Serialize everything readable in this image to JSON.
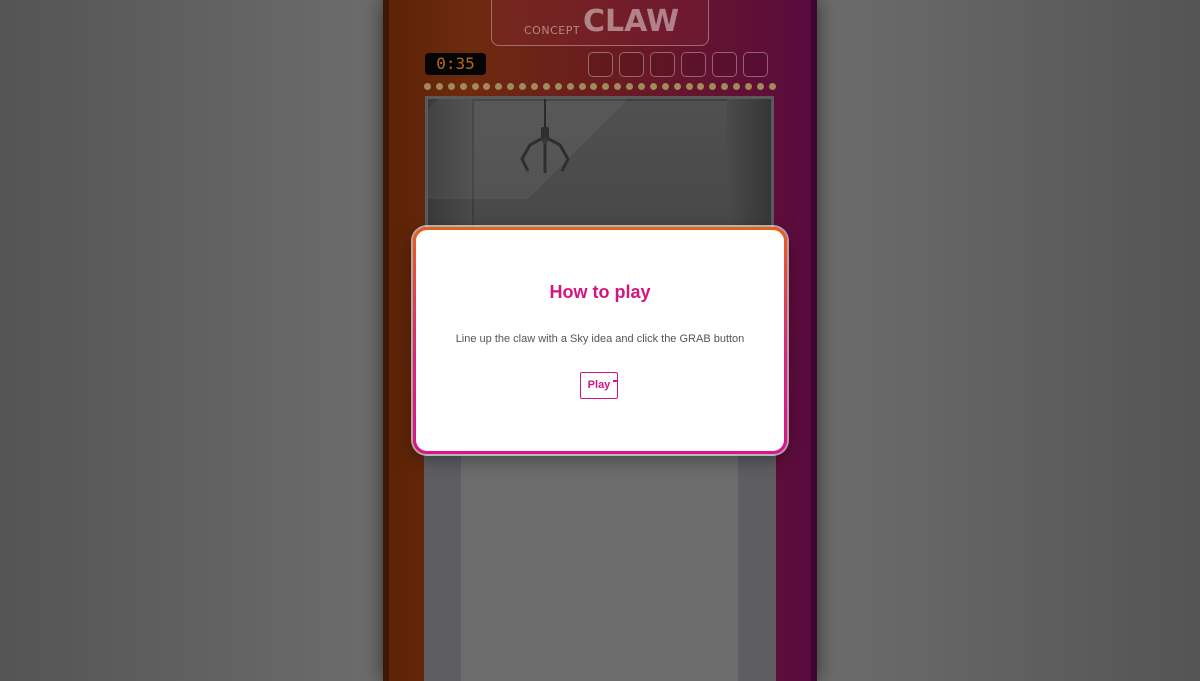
{
  "game": {
    "logo_prefix": "CONCEPT",
    "logo_title": "CLAW",
    "timer": "0:35",
    "prize_slots": 6,
    "colors": {
      "machine_left": "#6e2a0e",
      "machine_right": "#5a0a40",
      "accent": "#d4157f",
      "timer_text": "#b86a12"
    }
  },
  "modal": {
    "title": "How to play",
    "instructions": "Line up the claw with a Sky idea and click the GRAB button",
    "play_label": "Play"
  },
  "icons": {
    "claw": "claw-icon"
  }
}
